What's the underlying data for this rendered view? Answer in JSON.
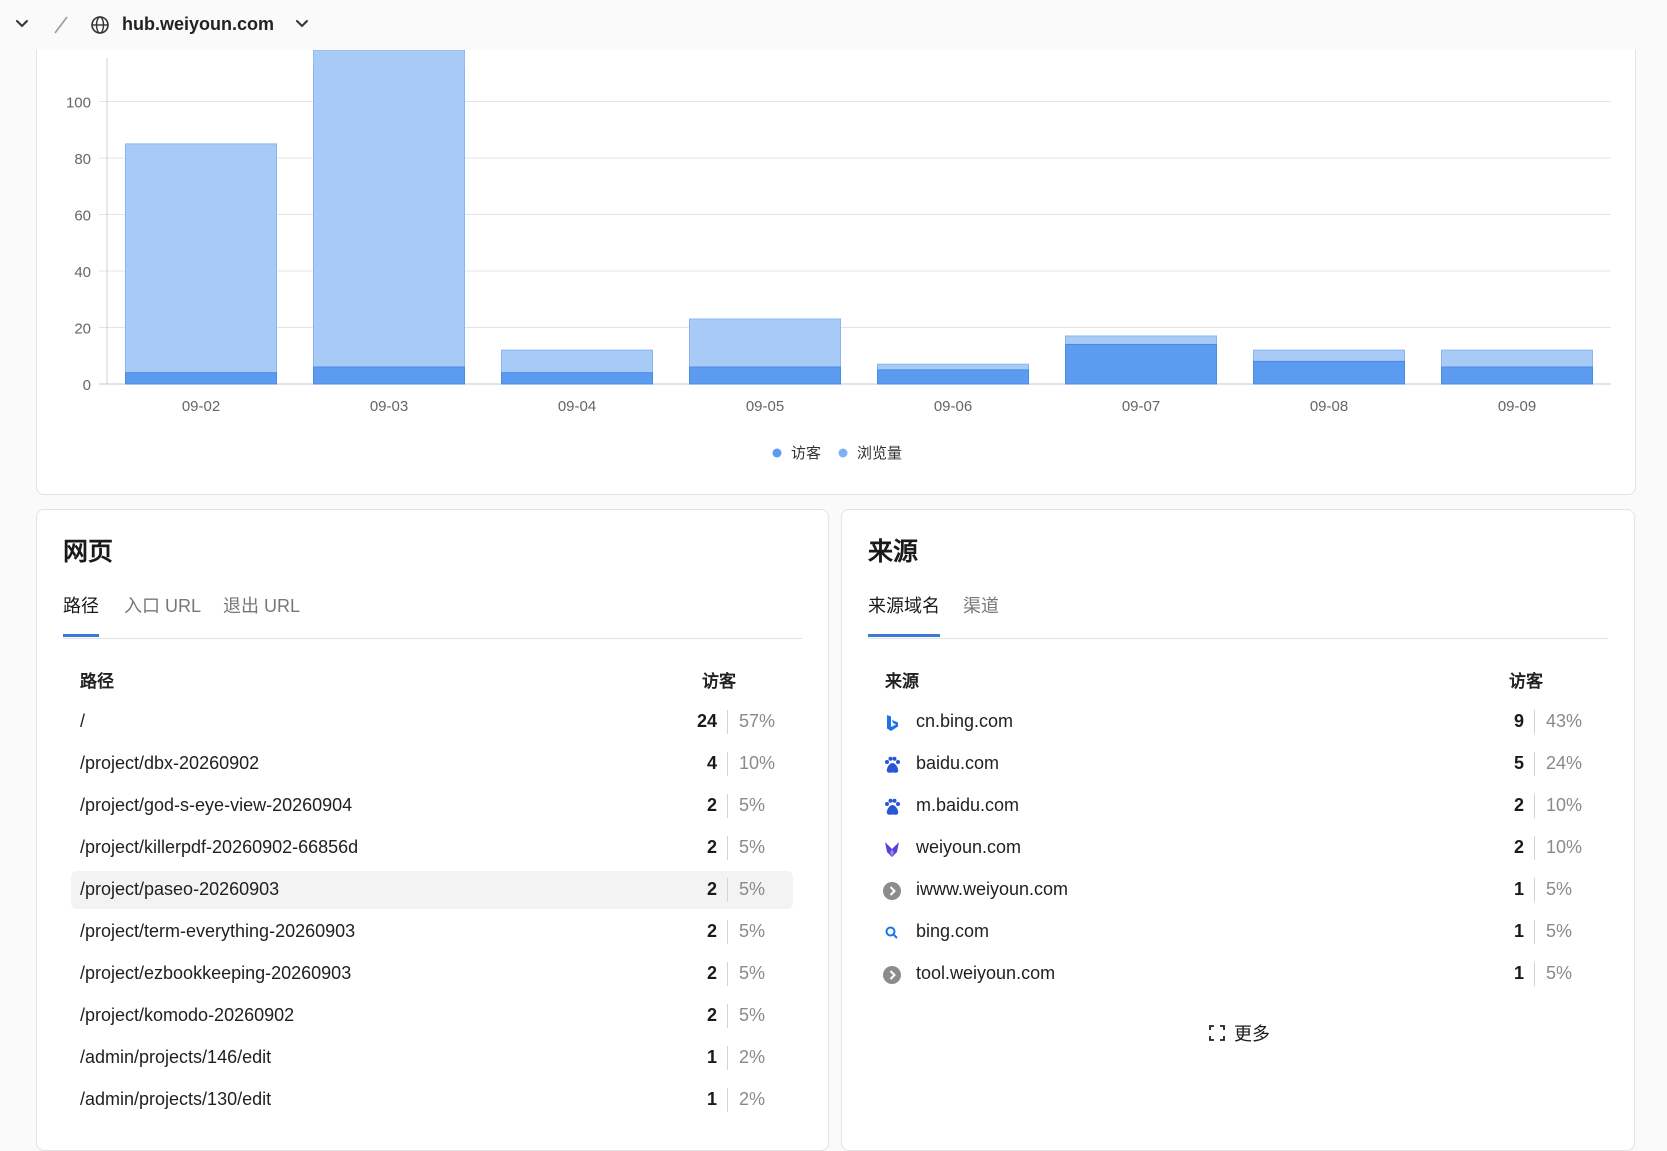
{
  "header": {
    "domain": "hub.weiyoun.com"
  },
  "colors": {
    "visitors": "#5b9cf0",
    "pageviews": "#a8caf6",
    "accent": "#3a7bd5"
  },
  "chart_data": {
    "type": "bar",
    "stacked": "overlay",
    "categories": [
      "09-02",
      "09-03",
      "09-04",
      "09-05",
      "09-06",
      "09-07",
      "09-08",
      "09-09"
    ],
    "series": [
      {
        "name": "访客",
        "values": [
          4,
          6,
          4,
          6,
          5,
          14,
          8,
          6
        ]
      },
      {
        "name": "浏览量",
        "values": [
          85,
          130,
          12,
          23,
          7,
          17,
          12,
          12
        ]
      }
    ],
    "y_ticks": [
      0,
      20,
      40,
      60,
      80,
      100
    ],
    "ylim": [
      0,
      100
    ],
    "grid": true,
    "legend": "bottom-center"
  },
  "pages": {
    "title": "网页",
    "tabs": [
      "路径",
      "入口 URL",
      "退出 URL"
    ],
    "col_path": "路径",
    "col_visitors": "访客",
    "rows": [
      {
        "path": "/",
        "count": "24",
        "pct": "57%"
      },
      {
        "path": "/project/dbx-20260902",
        "count": "4",
        "pct": "10%"
      },
      {
        "path": "/project/god-s-eye-view-20260904",
        "count": "2",
        "pct": "5%"
      },
      {
        "path": "/project/killerpdf-20260902-66856d",
        "count": "2",
        "pct": "5%"
      },
      {
        "path": "/project/paseo-20260903",
        "count": "2",
        "pct": "5%"
      },
      {
        "path": "/project/term-everything-20260903",
        "count": "2",
        "pct": "5%"
      },
      {
        "path": "/project/ezbookkeeping-20260903",
        "count": "2",
        "pct": "5%"
      },
      {
        "path": "/project/komodo-20260902",
        "count": "2",
        "pct": "5%"
      },
      {
        "path": "/admin/projects/146/edit",
        "count": "1",
        "pct": "2%"
      },
      {
        "path": "/admin/projects/130/edit",
        "count": "1",
        "pct": "2%"
      }
    ]
  },
  "sources": {
    "title": "来源",
    "tabs": [
      "来源域名",
      "渠道"
    ],
    "col_source": "来源",
    "col_visitors": "访客",
    "rows": [
      {
        "domain": "cn.bing.com",
        "icon": "bing-icon",
        "count": "9",
        "pct": "43%"
      },
      {
        "domain": "baidu.com",
        "icon": "baidu-icon",
        "count": "5",
        "pct": "24%"
      },
      {
        "domain": "m.baidu.com",
        "icon": "baidu-icon",
        "count": "2",
        "pct": "10%"
      },
      {
        "domain": "weiyoun.com",
        "icon": "weiyoun-icon",
        "count": "2",
        "pct": "10%"
      },
      {
        "domain": "iwww.weiyoun.com",
        "icon": "generic-arrow-icon",
        "count": "1",
        "pct": "5%"
      },
      {
        "domain": "bing.com",
        "icon": "search-icon",
        "count": "1",
        "pct": "5%"
      },
      {
        "domain": "tool.weiyoun.com",
        "icon": "generic-arrow-icon",
        "count": "1",
        "pct": "5%"
      }
    ],
    "more_label": "更多"
  }
}
